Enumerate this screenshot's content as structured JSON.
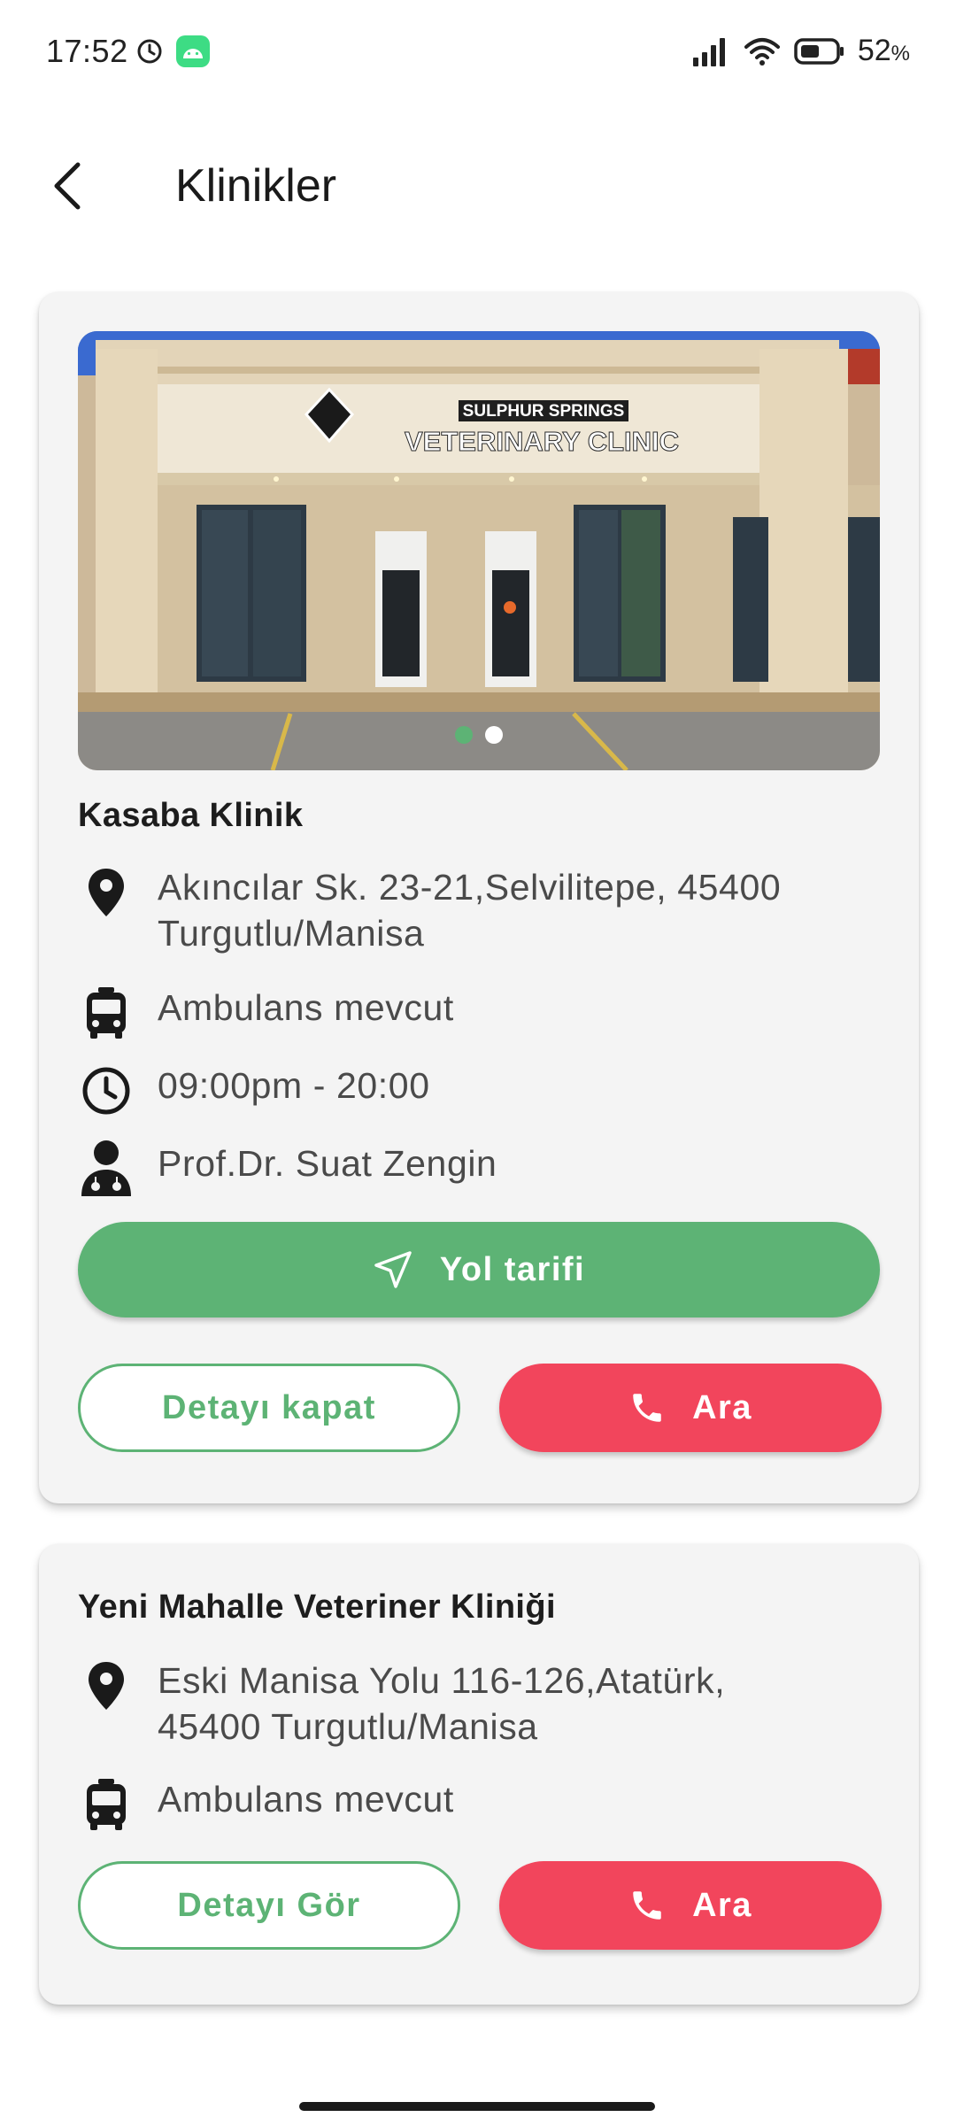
{
  "status_bar": {
    "time": "17:52",
    "battery_percent": "52",
    "battery_unit": "%",
    "icons": [
      "alarm-clock-icon",
      "android-icon",
      "signal-icon",
      "wifi-icon",
      "battery-icon"
    ]
  },
  "app_bar": {
    "title": "Klinikler",
    "back_icon": "back-arrow-icon"
  },
  "colors": {
    "primary_green": "#5db375",
    "call_red": "#f2455c",
    "card_bg": "#f4f4f4"
  },
  "clinics": [
    {
      "image_sign_line1": "SULPHUR SPRINGS",
      "image_sign_line2": "VETERINARY CLINIC",
      "carousel_index": 1,
      "carousel_count": 2,
      "name": "Kasaba Klinik",
      "address_line1": "Akıncılar Sk. 23-21,Selvilitepe, 45400",
      "address_line2": "Turgutlu/Manisa",
      "ambulance": "Ambulans mevcut",
      "hours": "09:00pm - 20:00",
      "doctor": "Prof.Dr. Suat Zengin",
      "directions_label": "Yol tarifi",
      "detail_label": "Detayı kapat",
      "call_label": "Ara"
    },
    {
      "name": "Yeni Mahalle Veteriner Kliniği",
      "address_line1": "Eski Manisa Yolu 116-126,Atatürk,",
      "address_line2": "45400 Turgutlu/Manisa",
      "ambulance": "Ambulans mevcut",
      "detail_label": "Detayı Gör",
      "call_label": "Ara"
    }
  ]
}
